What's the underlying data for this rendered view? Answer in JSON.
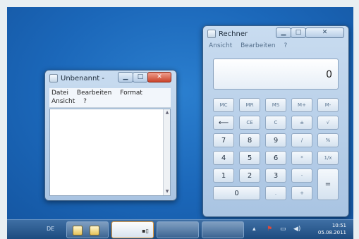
{
  "notepad": {
    "title": "Unbenannt -",
    "menu_row1": [
      "Datei",
      "Bearbeiten",
      "Format"
    ],
    "menu_row2": [
      "Ansicht",
      "?"
    ]
  },
  "calculator": {
    "title": "Rechner",
    "menu": [
      "Ansicht",
      "Bearbeiten",
      "?"
    ],
    "display": "0",
    "buttons": [
      [
        "MC",
        "MR",
        "MS",
        "M+",
        "M-"
      ],
      [
        "⟵",
        "CE",
        "C",
        "±",
        "√"
      ],
      [
        "7",
        "8",
        "9",
        "/",
        "%"
      ],
      [
        "4",
        "5",
        "6",
        "*",
        "1/x"
      ],
      [
        "1",
        "2",
        "3",
        "-",
        "="
      ],
      [
        "0",
        ".",
        "+"
      ]
    ]
  },
  "taskbar": {
    "language": "DE",
    "time": "10:51",
    "date": "05.08.2011",
    "tray_icons": [
      "flag-icon",
      "network-icon",
      "volume-icon"
    ]
  }
}
